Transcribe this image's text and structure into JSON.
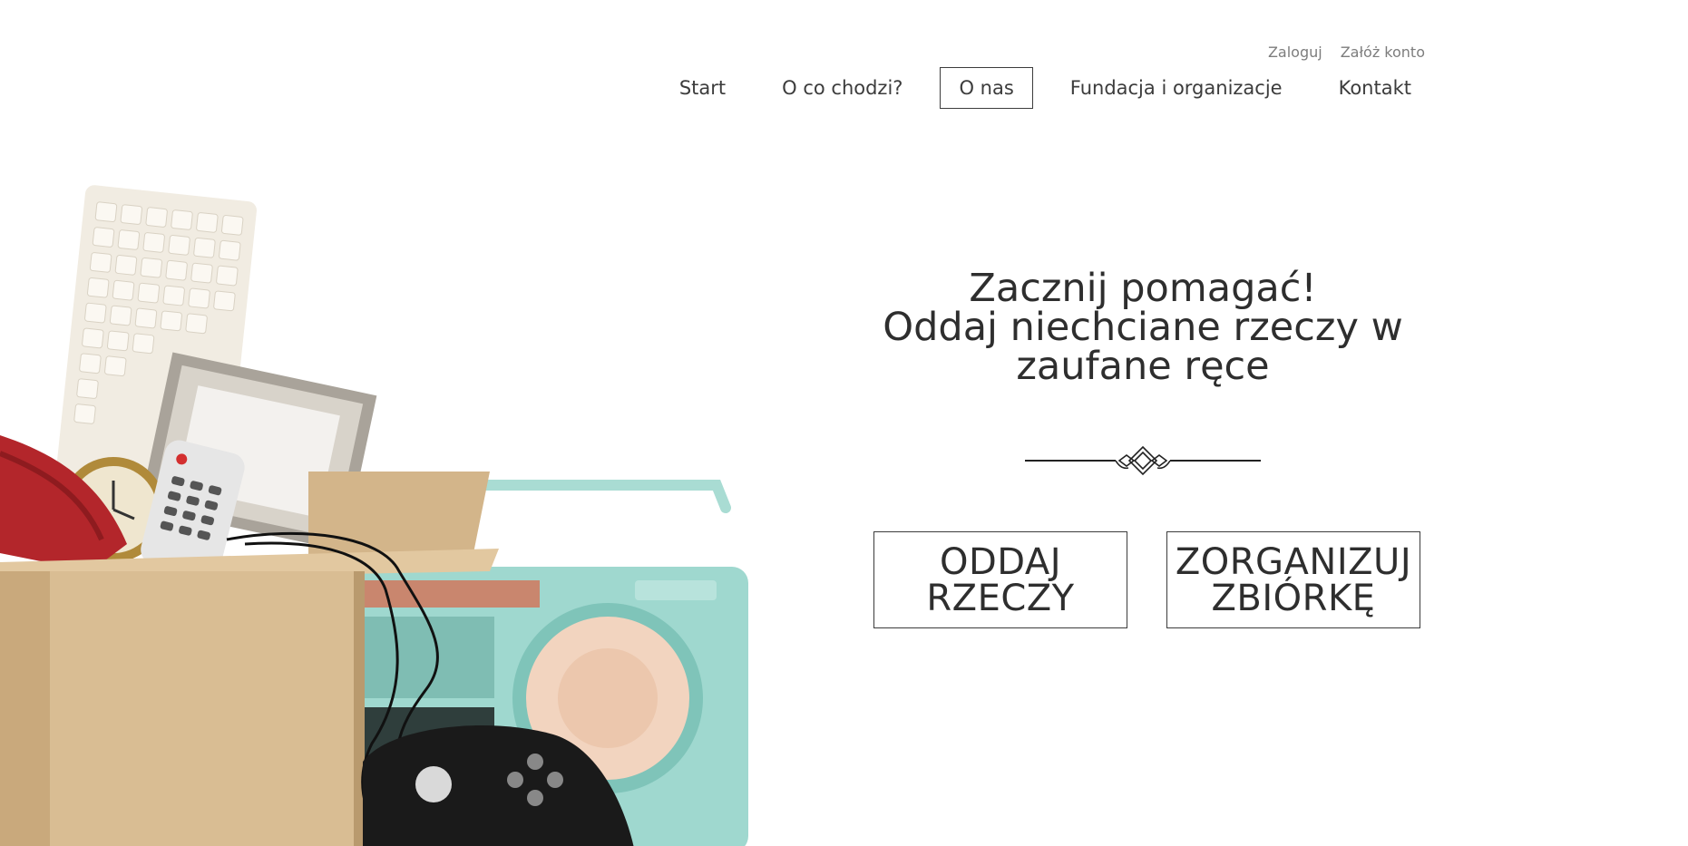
{
  "auth": {
    "login": "Zaloguj",
    "register": "Załóż konto"
  },
  "nav": {
    "items": [
      {
        "label": "Start"
      },
      {
        "label": "O co chodzi?"
      },
      {
        "label": "O nas",
        "active": true
      },
      {
        "label": "Fundacja i organizacje"
      },
      {
        "label": "Kontakt"
      }
    ]
  },
  "hero": {
    "headline": {
      "line1": "Zacznij pomagać!",
      "line2": "Oddaj niechciane rzeczy w",
      "line3": "zaufane ręce"
    },
    "buttons": {
      "give": {
        "line1": "ODDAJ",
        "line2": "RZECZY"
      },
      "organize": {
        "line1": "ZORGANIZUJ",
        "line2": "ZBIÓRKĘ"
      }
    },
    "image_icon": "box-of-donated-items-image",
    "ornament_icon": "decorative-divider-icon"
  },
  "colors": {
    "text": "#2e2e2e",
    "muted": "#7d7d7d",
    "border": "#3c3c3c",
    "background": "#ffffff"
  }
}
